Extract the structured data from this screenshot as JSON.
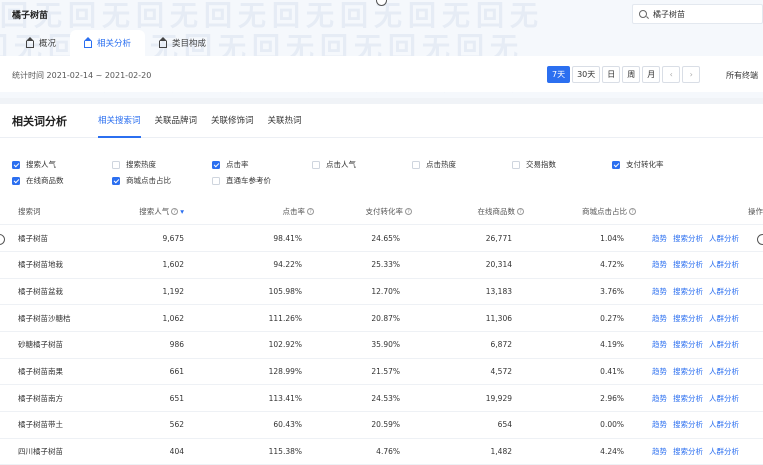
{
  "header": {
    "watermark": "回无回无回无回无回无回无回无回无",
    "title": "橘子树苗",
    "search_value": "橘子树苗"
  },
  "tabs": [
    {
      "label": "概况"
    },
    {
      "label": "相关分析"
    },
    {
      "label": "类目构成"
    }
  ],
  "datebar": {
    "stat_label": "统计时间 2021-02-14 ~ 2021-02-20",
    "buttons": [
      "7天",
      "30天",
      "日",
      "周",
      "月"
    ],
    "prev": "‹",
    "next": "›",
    "all_terminals": "所有终端"
  },
  "section": {
    "title": "相关词分析",
    "subtabs": [
      "相关搜索词",
      "关联品牌词",
      "关联修饰词",
      "关联热词"
    ]
  },
  "checkboxes": [
    {
      "label": "搜索人气",
      "checked": true
    },
    {
      "label": "搜索热度",
      "checked": false
    },
    {
      "label": "点击率",
      "checked": true
    },
    {
      "label": "点击人气",
      "checked": false
    },
    {
      "label": "点击热度",
      "checked": false
    },
    {
      "label": "交易指数",
      "checked": false
    },
    {
      "label": "支付转化率",
      "checked": true
    },
    {
      "label": "在线商品数",
      "checked": true
    },
    {
      "label": "商城点击占比",
      "checked": true
    },
    {
      "label": "直通车参考价",
      "checked": false
    }
  ],
  "table": {
    "headers": [
      "搜索词",
      "搜索人气",
      "点击率",
      "支付转化率",
      "在线商品数",
      "商城点击占比",
      "操作"
    ],
    "action_labels": [
      "趋势",
      "搜索分析",
      "人群分析"
    ],
    "rows": [
      [
        "橘子树苗",
        "9,675",
        "98.41%",
        "24.65%",
        "26,771",
        "1.04%"
      ],
      [
        "橘子树苗地栽",
        "1,602",
        "94.22%",
        "25.33%",
        "20,314",
        "4.72%"
      ],
      [
        "橘子树苗盆栽",
        "1,192",
        "105.98%",
        "12.70%",
        "13,183",
        "3.76%"
      ],
      [
        "橘子树苗沙糖桔",
        "1,062",
        "111.26%",
        "20.87%",
        "11,306",
        "0.27%"
      ],
      [
        "砂糖橘子树苗",
        "986",
        "102.92%",
        "35.90%",
        "6,872",
        "4.19%"
      ],
      [
        "橘子树苗南果",
        "661",
        "128.99%",
        "21.57%",
        "4,572",
        "0.41%"
      ],
      [
        "橘子树苗南方",
        "651",
        "113.41%",
        "24.53%",
        "19,929",
        "2.96%"
      ],
      [
        "橘子树苗带土",
        "562",
        "60.43%",
        "20.59%",
        "654",
        "0.00%"
      ],
      [
        "四川橘子树苗",
        "404",
        "115.38%",
        "4.76%",
        "1,482",
        "4.24%"
      ]
    ]
  },
  "colors": {
    "accent": "#2b6ff0"
  }
}
